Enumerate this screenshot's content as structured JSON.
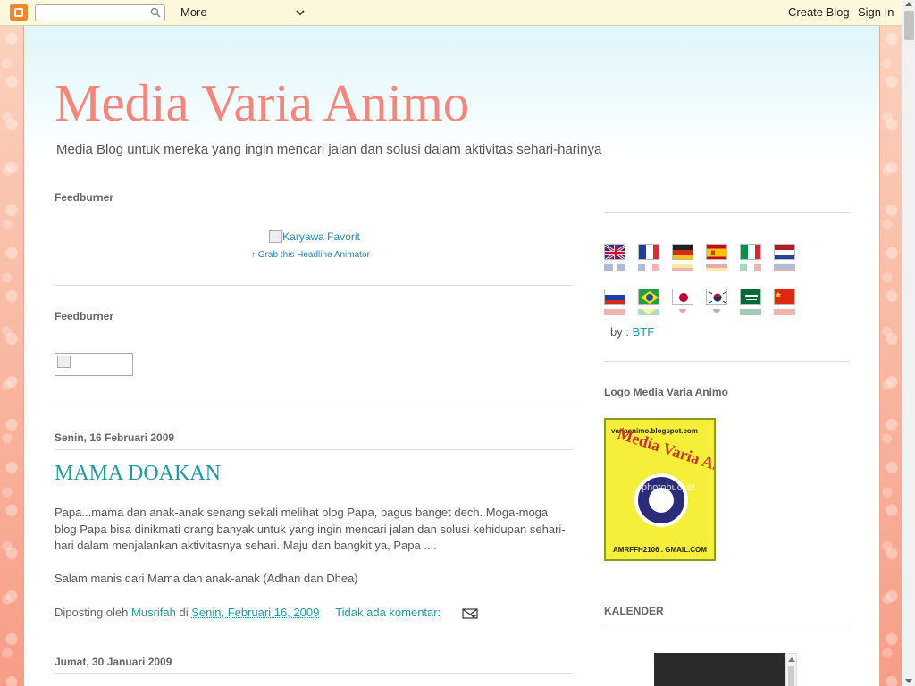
{
  "navbar": {
    "search_value": "",
    "more_label": "More",
    "create_blog_label": "Create Blog",
    "sign_in_label": "Sign In"
  },
  "blog": {
    "title": "Media Varia Animo",
    "description": "Media Blog untuk mereka yang ingin mencari jalan dan solusi dalam aktivitas sehari-harinya"
  },
  "main": {
    "widget1_title": "Feedburner",
    "headline_image_alt": "Karyawa Favorit",
    "headline_link": "↑ Grab this Headline Animator",
    "widget2_title": "Feedburner",
    "posts": [
      {
        "date": "Senin, 16 Februari 2009",
        "title": "MAMA DOAKAN",
        "paragraph1": "Papa...mama dan anak-anak senang sekali melihat blog Papa, bagus banget dech. Moga-moga blog Papa bisa dinikmati orang banyak untuk yang ingin mencari jalan dan solusi kehidupan sehari-hari dalam menjalankan aktivitasnya sehari. Maju dan bangkit ya, Papa ....",
        "paragraph2": "Salam manis dari Mama dan anak-anak (Adhan dan Dhea)",
        "posted_by_label": "Diposting oleh",
        "author": "Musrifah",
        "at_label": "di",
        "timestamp": "Senin, Februari 16, 2009",
        "comments": "Tidak ada komentar:"
      }
    ],
    "next_date": "Jumat, 30 Januari 2009"
  },
  "sidebar": {
    "flags": [
      "english-flag",
      "french-flag",
      "german-flag",
      "spanish-flag",
      "italian-flag",
      "dutch-flag",
      "russian-flag",
      "brazil-flag",
      "japan-flag",
      "korea-flag",
      "saudi-flag",
      "china-flag"
    ],
    "by_label": "by :",
    "by_link": "BTF",
    "logo_title": "Logo Media Varia Animo",
    "logo_url_text": "variaanimo.blogspot.com",
    "logo_email_text": "AMRFFH2106 . GMAIL.COM",
    "logo_watermark": "photobucket",
    "calendar_title": "KALENDER"
  },
  "colors": {
    "title": "#f4877d",
    "link": "#2198a6",
    "navbar_bg": "#fbf8dc"
  }
}
